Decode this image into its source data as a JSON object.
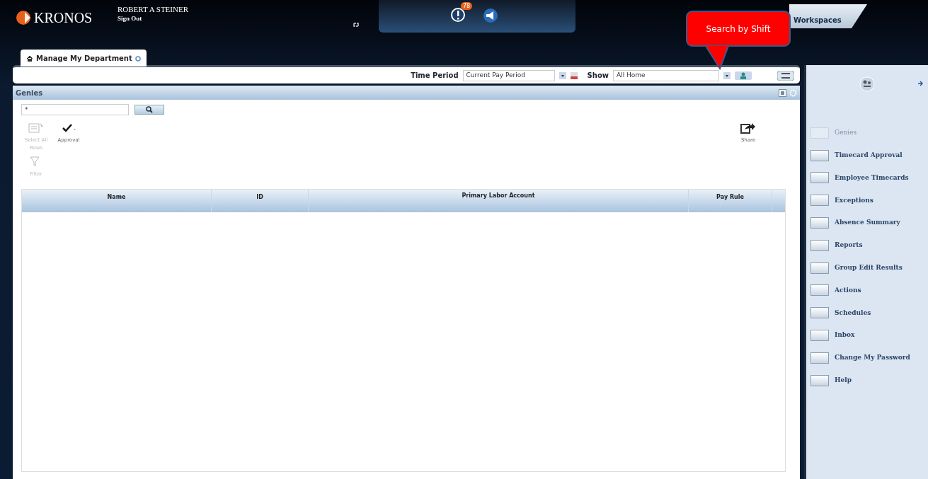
{
  "header": {
    "logo": "KRONOS",
    "user_name": "ROBERT A STEINER",
    "sign_out": "Sign Out",
    "alert_badge": "78",
    "workspaces": "Workspaces"
  },
  "tabs": [
    {
      "label": "Manage My Department",
      "selected": true
    }
  ],
  "toolbar": {
    "time_period_label": "Time Period",
    "time_period_value": "Current Pay Period",
    "show_label": "Show",
    "show_value": "All Home"
  },
  "callout": {
    "text": "Search by Shift"
  },
  "genies_panel": {
    "title": "Genies",
    "search_value": "*",
    "actions": [
      {
        "label": "Select All Rows",
        "kind": "select",
        "disabled": true
      },
      {
        "label": "Approval",
        "kind": "approve",
        "disabled": false
      },
      {
        "label": "Share",
        "kind": "share",
        "disabled": false
      },
      {
        "label": "Filter",
        "kind": "filter",
        "disabled": true
      }
    ],
    "table": {
      "columns": [
        "Name",
        "ID",
        "Primary Labor Account",
        "Pay Rule"
      ]
    }
  },
  "sidebar": {
    "items": [
      {
        "label": "Genies",
        "disabled": true
      },
      {
        "label": "Timecard Approval",
        "disabled": false
      },
      {
        "label": "Employee Timecards",
        "disabled": false
      },
      {
        "label": "Exceptions",
        "disabled": false
      },
      {
        "label": "Absence Summary",
        "disabled": false
      },
      {
        "label": "Reports",
        "disabled": false
      },
      {
        "label": "Group Edit Results",
        "disabled": false
      },
      {
        "label": "Actions",
        "disabled": false
      },
      {
        "label": "Schedules",
        "disabled": false
      },
      {
        "label": "Inbox",
        "disabled": false
      },
      {
        "label": "Change My Password",
        "disabled": false
      },
      {
        "label": "Help",
        "disabled": false
      }
    ]
  }
}
